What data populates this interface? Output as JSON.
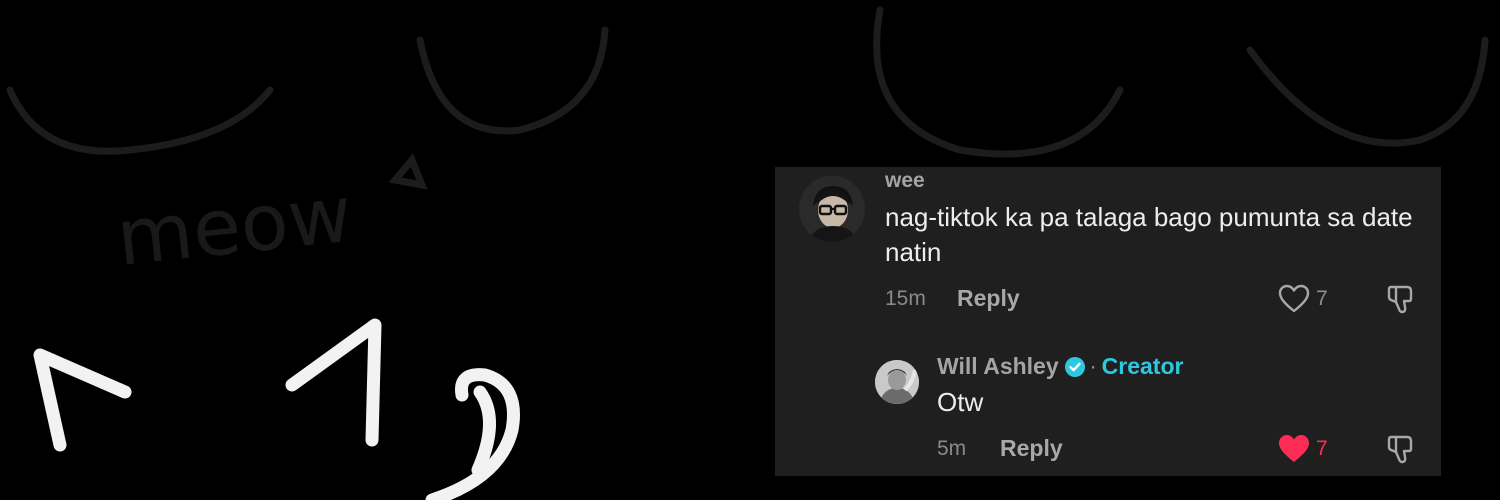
{
  "background": {
    "color": "#000000",
    "doodle_text": "meow"
  },
  "comment": {
    "username": "wee",
    "text": "nag-tiktok ka pa talaga bago pumunta sa date natin",
    "time": "15m",
    "reply_label": "Reply",
    "likes": "7",
    "liked": false
  },
  "reply": {
    "username": "Will Ashley",
    "verified": true,
    "separator": "·",
    "badge": "Creator",
    "text": "Otw",
    "time": "5m",
    "reply_label": "Reply",
    "likes": "7",
    "liked": true
  },
  "colors": {
    "panel_bg": "#1f1f1f",
    "creator_accent": "#2dc8e0",
    "liked_heart": "#fe2c55",
    "text_primary": "#ededed",
    "text_secondary": "#a4a4a4"
  },
  "icons": {
    "like": "heart-outline-icon",
    "liked": "heart-filled-icon",
    "dislike": "thumbs-down-icon",
    "verified": "verified-check-icon"
  }
}
